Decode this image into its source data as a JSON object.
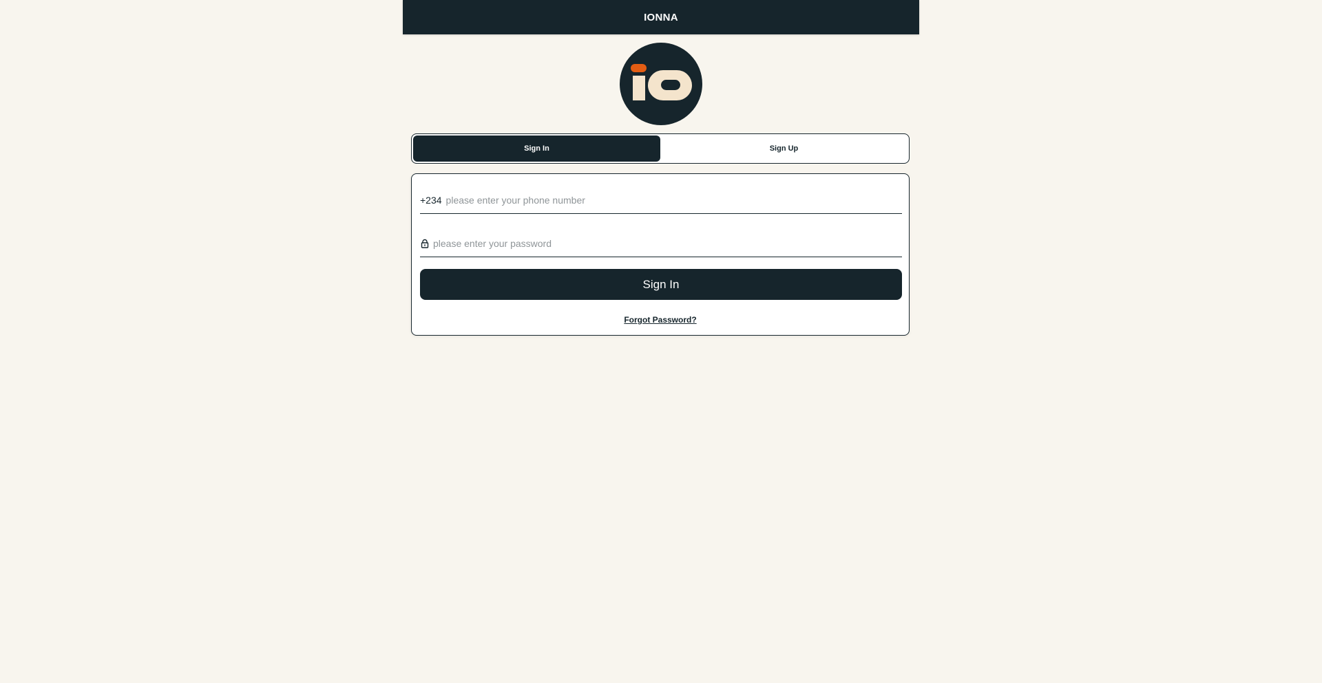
{
  "header": {
    "title": "IONNA"
  },
  "logo": {
    "icon": "ionna-logo",
    "colors": {
      "circle": "#16252c",
      "letters": "#f4e4cc",
      "accent": "#e35d13"
    }
  },
  "tabs": [
    {
      "label": "Sign In",
      "active": true
    },
    {
      "label": "Sign Up",
      "active": false
    }
  ],
  "form": {
    "phone": {
      "prefix": "+234",
      "placeholder": "please enter your phone number",
      "value": ""
    },
    "password": {
      "icon": "lock-icon",
      "placeholder": "please enter your password",
      "value": ""
    },
    "submit_label": "Sign In",
    "forgot_label": "Forgot Password?"
  },
  "colors": {
    "primary": "#16252c",
    "background": "#f8f5ee",
    "accent": "#e35d13"
  }
}
